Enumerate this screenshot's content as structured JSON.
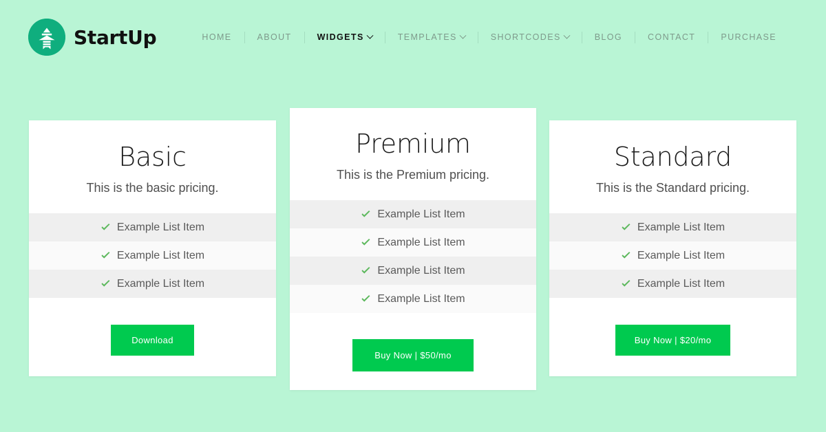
{
  "brand": {
    "name": "StartUp",
    "logo_icon": "stacked-pyramid-icon",
    "logo_color": "#0fae7e"
  },
  "nav": {
    "items": [
      {
        "label": "HOME",
        "active": false,
        "has_dropdown": false
      },
      {
        "label": "ABOUT",
        "active": false,
        "has_dropdown": false
      },
      {
        "label": "WIDGETS",
        "active": true,
        "has_dropdown": true
      },
      {
        "label": "TEMPLATES",
        "active": false,
        "has_dropdown": true
      },
      {
        "label": "SHORTCODES",
        "active": false,
        "has_dropdown": true
      },
      {
        "label": "BLOG",
        "active": false,
        "has_dropdown": false
      },
      {
        "label": "CONTACT",
        "active": false,
        "has_dropdown": false
      },
      {
        "label": "PURCHASE",
        "active": false,
        "has_dropdown": false
      }
    ]
  },
  "colors": {
    "page_background": "#b9f5d5",
    "accent_button": "#00ca4f",
    "check": "#5cb85c",
    "row_odd": "#efefef",
    "row_even": "#fafafa"
  },
  "pricing": {
    "cards": [
      {
        "id": "basic",
        "title": "Basic",
        "subtitle": "This is the basic pricing.",
        "features": [
          "Example List Item",
          "Example List Item",
          "Example List Item"
        ],
        "cta_label": "Download",
        "featured": false
      },
      {
        "id": "premium",
        "title": "Premium",
        "subtitle": "This is the Premium pricing.",
        "features": [
          "Example List Item",
          "Example List Item",
          "Example List Item",
          "Example List Item"
        ],
        "cta_label": "Buy Now | $50/mo",
        "featured": true
      },
      {
        "id": "standard",
        "title": "Standard",
        "subtitle": "This is the Standard pricing.",
        "features": [
          "Example List Item",
          "Example List Item",
          "Example List Item"
        ],
        "cta_label": "Buy Now | $20/mo",
        "featured": false
      }
    ]
  }
}
